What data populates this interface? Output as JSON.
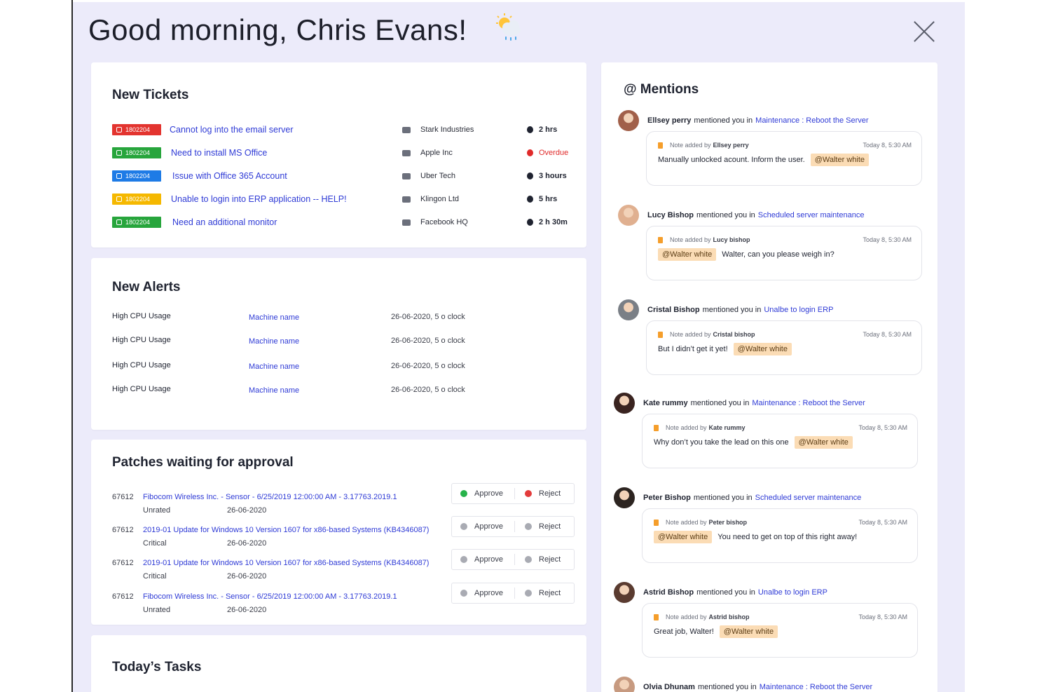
{
  "header": {
    "greeting": "Good morning, Chris Evans!",
    "weather_icon": "sun-behind-rain-cloud-icon"
  },
  "colors": {
    "red": "#e3342f",
    "green": "#27a53c",
    "blue": "#1e7be6",
    "yellow": "#f5b800",
    "link": "#2f3bd6",
    "overdue": "#e02a2a"
  },
  "tickets": {
    "title": "New Tickets",
    "rows": [
      {
        "id": "1802204",
        "color": "#e3342f",
        "title": "Cannot log into the email server",
        "company": "Stark Industries",
        "time": "2 hrs",
        "overdue": false
      },
      {
        "id": "1802204",
        "color": "#27a53c",
        "title": "Need to install MS Office",
        "company": "Apple Inc",
        "time": "Overdue",
        "overdue": true
      },
      {
        "id": "1802204",
        "color": "#1e7be6",
        "title": "Issue with Office 365 Account",
        "company": "Uber Tech",
        "time": "3 hours",
        "overdue": false
      },
      {
        "id": "1802204",
        "color": "#f5b800",
        "title": "Unable to login into ERP application -- HELP!",
        "company": "Klingon Ltd",
        "time": "5 hrs",
        "overdue": false
      },
      {
        "id": "1802204",
        "color": "#27a53c",
        "title": "Need an additional monitor",
        "company": "Facebook HQ",
        "time": "2 h 30m",
        "overdue": false
      }
    ]
  },
  "alerts": {
    "title": "New Alerts",
    "rows": [
      {
        "type": "High CPU Usage",
        "machine": "Machine name",
        "date": "26-06-2020,  5 o clock"
      },
      {
        "type": "High CPU Usage",
        "machine": "Machine name",
        "date": "26-06-2020,  5 o clock"
      },
      {
        "type": "High CPU Usage",
        "machine": "Machine name",
        "date": "26-06-2020,  5 o clock"
      },
      {
        "type": "High CPU Usage",
        "machine": "Machine name",
        "date": "26-06-2020,  5 o clock"
      }
    ]
  },
  "patches": {
    "title": "Patches waiting for approval",
    "approve_label": "Approve",
    "reject_label": "Reject",
    "rows": [
      {
        "id": "67612",
        "name": "Fibocom Wireless Inc. - Sensor - 6/25/2019 12:00:00 AM - 3.17763.2019.1",
        "severity": "Unrated",
        "date": "26-06-2020",
        "active": true
      },
      {
        "id": "67612",
        "name": "2019-01 Update for Windows 10 Version 1607 for x86-based Systems (KB4346087)",
        "severity": "Critical",
        "date": "26-06-2020",
        "active": false
      },
      {
        "id": "67612",
        "name": "2019-01 Update for Windows 10 Version 1607 for x86-based Systems (KB4346087)",
        "severity": "Critical",
        "date": "26-06-2020",
        "active": false
      },
      {
        "id": "67612",
        "name": "Fibocom Wireless Inc. - Sensor - 6/25/2019 12:00:00 AM - 3.17763.2019.1",
        "severity": "Unrated",
        "date": "26-06-2020",
        "active": false
      }
    ]
  },
  "tasks": {
    "title": "Today’s Tasks"
  },
  "mentions": {
    "title": "@ Mentions",
    "mentioned_text": "mentioned you in",
    "note_prefix": "Note added by",
    "items": [
      {
        "who": "Ellsey perry",
        "link": "Maintenance : Reboot the Server",
        "note_by": "Ellsey perry",
        "when": "Today 8, 5:30 AM",
        "text": "Manually unlocked acount. Inform the user.",
        "tag": "@Walter white",
        "tag_first": false
      },
      {
        "who": "Lucy Bishop",
        "link": "Scheduled server maintenance",
        "note_by": "Lucy bishop",
        "when": "Today 8, 5:30 AM",
        "text": "Walter, can you please weigh in?",
        "tag": "@Walter white",
        "tag_first": true
      },
      {
        "who": "Cristal Bishop",
        "link": "Unalbe to login ERP",
        "note_by": "Cristal bishop",
        "when": "Today 8, 5:30 AM",
        "text": "But I didn’t get it yet!",
        "tag": "@Walter white",
        "tag_first": false
      },
      {
        "who": "Kate rummy",
        "link": "Maintenance : Reboot the Server",
        "note_by": "Kate rummy",
        "when": "Today 8, 5:30 AM",
        "text": "Why don’t you take the lead on this one",
        "tag": "@Walter white",
        "tag_first": false
      },
      {
        "who": "Peter Bishop",
        "link": "Scheduled server maintenance",
        "note_by": "Peter bishop",
        "when": "Today 8, 5:30 AM",
        "text": "You need to get on top of this right away!",
        "tag": "@Walter white",
        "tag_first": true
      },
      {
        "who": "Astrid Bishop",
        "link": "Unalbe to login ERP",
        "note_by": "Astrid bishop",
        "when": "Today 8, 5:30 AM",
        "text": "Great job, Walter!",
        "tag": "@Walter white",
        "tag_first": false
      },
      {
        "who": "Olvia Dhunam",
        "link": "Maintenance : Reboot the Server"
      }
    ]
  }
}
